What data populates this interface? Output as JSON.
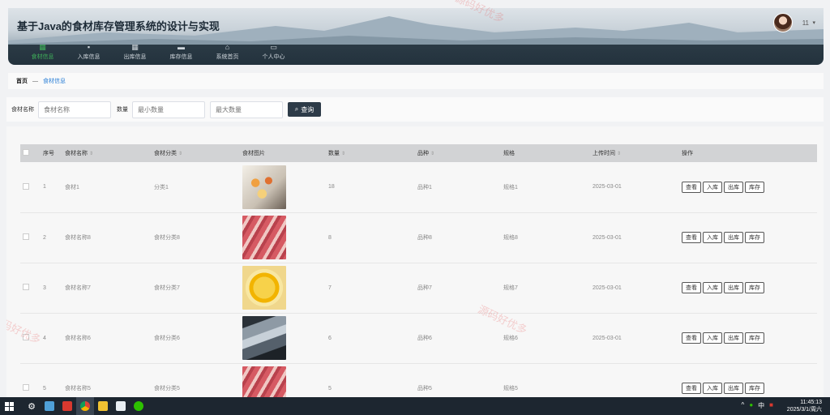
{
  "header": {
    "title": "基于Java的食材库存管理系统的设计与实现",
    "user": "11",
    "nav": [
      {
        "label": "食材信息",
        "icon": "grid-icon",
        "active": true
      },
      {
        "label": "入库信息",
        "icon": "box-icon"
      },
      {
        "label": "出库信息",
        "icon": "grid-icon"
      },
      {
        "label": "库存信息",
        "icon": "folder-icon"
      },
      {
        "label": "系统首页",
        "icon": "home-icon"
      },
      {
        "label": "个人中心",
        "icon": "card-icon"
      }
    ]
  },
  "breadcrumb": {
    "home": "首页",
    "sep": "—",
    "current": "食材信息"
  },
  "search": {
    "name_label": "食材名称",
    "name_placeholder": "食材名称",
    "qty_label": "数量",
    "min_placeholder": "最小数量",
    "max_placeholder": "最大数量",
    "query_label": "查询"
  },
  "table": {
    "headers": [
      "序号",
      "食材名称",
      "食材分类",
      "食材图片",
      "数量",
      "品种",
      "规格",
      "上传时间",
      "操作"
    ],
    "actions": [
      "查看",
      "入库",
      "出库",
      "库存"
    ],
    "rows": [
      {
        "no": "1",
        "name": "食材1",
        "category": "分类1",
        "image": "dessert-platter",
        "qty": "18",
        "breed": "品种1",
        "spec": "规格1",
        "time": "2025-03-01"
      },
      {
        "no": "2",
        "name": "食材名称8",
        "category": "食材分类8",
        "image": "meat-skewers",
        "qty": "8",
        "breed": "品种8",
        "spec": "规格8",
        "time": "2025-03-01"
      },
      {
        "no": "3",
        "name": "食材名称7",
        "category": "食材分类7",
        "image": "mango-slices",
        "qty": "7",
        "breed": "品种7",
        "spec": "规格7",
        "time": "2025-03-01"
      },
      {
        "no": "4",
        "name": "食材名称6",
        "category": "食材分类6",
        "image": "fish",
        "qty": "6",
        "breed": "品种6",
        "spec": "规格6",
        "time": "2025-03-01"
      },
      {
        "no": "5",
        "name": "食材名称5",
        "category": "食材分类5",
        "image": "meat-skewers",
        "qty": "5",
        "breed": "品种5",
        "spec": "规格5",
        "time": ""
      }
    ]
  },
  "watermark": "源码好优多",
  "taskbar": {
    "ime": "中",
    "time": "11:45:13",
    "date": "2025/3/1/周六"
  }
}
